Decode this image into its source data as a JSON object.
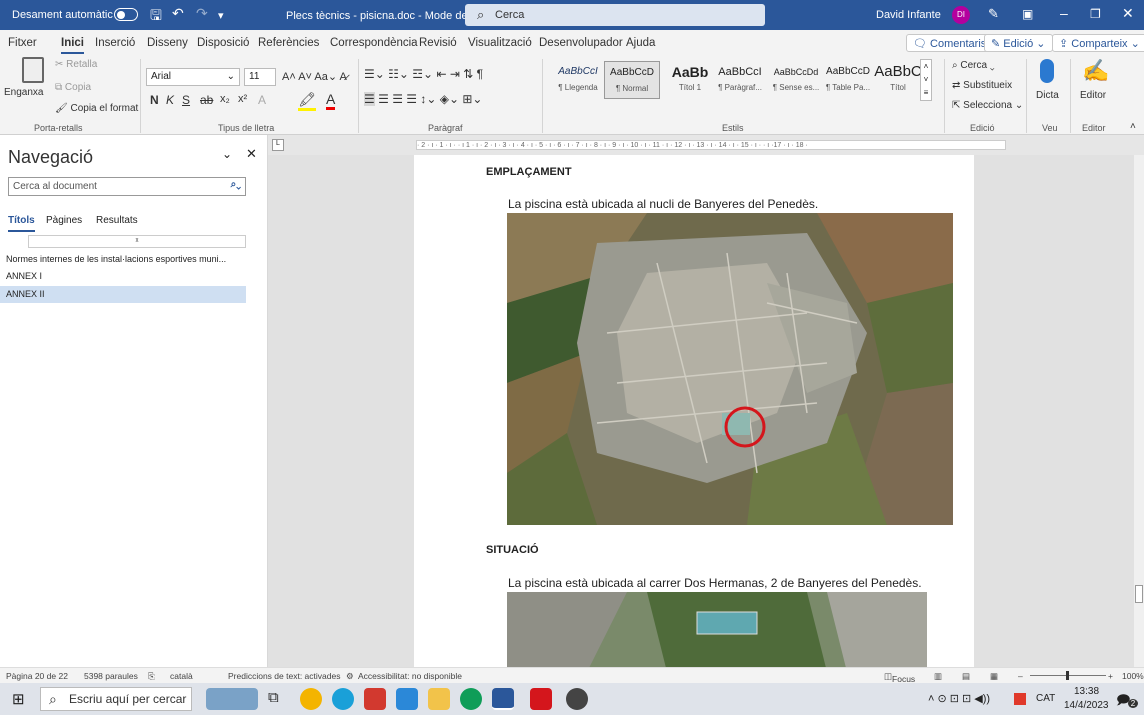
{
  "titlebar": {
    "autosave": "Desament automàtic",
    "doc_title": "Plecs tècnics - pisicna.doc  -  Mode de compatibilitat • Desat ⌄",
    "search_placeholder": "Cerca",
    "user": "David Infante",
    "initials": "DI"
  },
  "menu": {
    "items": [
      "Fitxer",
      "Inici",
      "Inserció",
      "Disseny",
      "Disposició",
      "Referències",
      "Correspondència",
      "Revisió",
      "Visualització",
      "Desenvolupador",
      "Ajuda"
    ],
    "comments": "Comentaris",
    "editing": "Edició",
    "share": "Comparteix"
  },
  "ribbon": {
    "clipboard": {
      "paste": "Enganxa",
      "cut": "Retalla",
      "copy": "Copia",
      "format_painter": "Copia el format",
      "group": "Porta-retalls"
    },
    "font": {
      "name": "Arial",
      "size": "11",
      "group": "Tipus de lletra",
      "bold": "N",
      "italic": "K",
      "underline": "S",
      "subscript": "x₂",
      "superscript": "x²"
    },
    "paragraph": {
      "group": "Paràgraf"
    },
    "styles": {
      "items": [
        {
          "preview": "AaBbCcI",
          "label": "¶ Llegenda"
        },
        {
          "preview": "AaBbCcD",
          "label": "¶ Normal"
        },
        {
          "preview": "AaBb",
          "label": "Títol 1"
        },
        {
          "preview": "AaBbCcI",
          "label": "¶ Paràgraf..."
        },
        {
          "preview": "AaBbCcDd",
          "label": "¶ Sense es..."
        },
        {
          "preview": "AaBbCcD",
          "label": "¶ Table Pa..."
        },
        {
          "preview": "AaBbC",
          "label": "Títol"
        }
      ],
      "group": "Estils"
    },
    "editing": {
      "find": "Cerca",
      "replace": "Substitueix",
      "select": "Selecciona",
      "group": "Edició"
    },
    "voice": {
      "dictate": "Dicta",
      "group": "Veu"
    },
    "editor": {
      "label": "Editor",
      "group": "Editor"
    }
  },
  "navigation": {
    "title": "Navegació",
    "search_placeholder": "Cerca al document",
    "tabs": [
      "Títols",
      "Pàgines",
      "Resultats"
    ],
    "items": [
      "Normes internes de les instal·lacions esportives muni...",
      "ANNEX I",
      "ANNEX II"
    ]
  },
  "ruler": {
    "text": "· 2 · ı · 1 · ı ·  ·  ı  1 · ı · 2 · ı · 3 · ı · 4 · ı · 5 · ı · 6 · ı · 7 · ı · 8 · ı · 9 · ı · 10 · ı · 11 · ı · 12 · ı · 13 · ı · 14 · ı · 15 · ı ·  · ı ·17 · ı · 18 ·"
  },
  "document": {
    "heading1": "EMPLAÇAMENT",
    "para1": "La piscina està ubicada al nucli de Banyeres del Penedès.",
    "heading2": "SITUACIÓ",
    "para2": "La piscina està ubicada al carrer Dos Hermanas, 2 de Banyeres del Penedès."
  },
  "status": {
    "page": "Pàgina 20 de 22",
    "words": "5398 paraules",
    "language": "català",
    "predictions": "Prediccions de text: activades",
    "accessibility": "Accessibilitat: no disponible",
    "focus": "Focus",
    "zoom": "100%"
  },
  "taskbar": {
    "search": "Escriu aquí per cercar",
    "time": "13:38",
    "date": "14/4/2023",
    "lang": "CAT",
    "notifications": "2"
  }
}
